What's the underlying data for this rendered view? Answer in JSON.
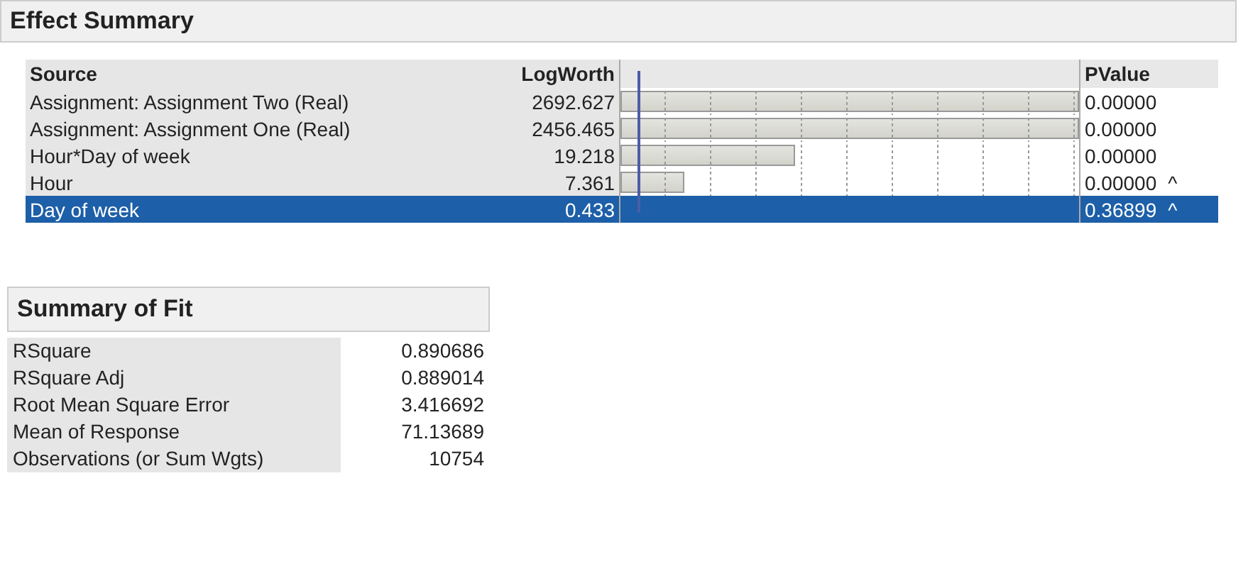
{
  "effect_summary": {
    "title": "Effect Summary",
    "columns": {
      "source": "Source",
      "logworth": "LogWorth",
      "pvalue": "PValue"
    },
    "rows": [
      {
        "source": "Assignment: Assignment Two (Real)",
        "logworth": "2692.627",
        "level": 1,
        "pvalue": "0.00000",
        "caret": "",
        "selected": false
      },
      {
        "source": "Assignment: Assignment One (Real)",
        "logworth": "2456.465",
        "level": 1,
        "pvalue": "0.00000",
        "caret": "",
        "selected": false
      },
      {
        "source": "Hour*Day of week",
        "logworth": "19.218",
        "level": 0.38,
        "pvalue": "0.00000",
        "caret": "",
        "selected": false
      },
      {
        "source": "Hour",
        "logworth": "7.361",
        "level": 0.14,
        "pvalue": "0.00000",
        "caret": "^",
        "selected": false
      },
      {
        "source": "Day of week",
        "logworth": "0.433",
        "level": 0.01,
        "pvalue": "0.36899",
        "caret": "^",
        "selected": true
      }
    ]
  },
  "summary_of_fit": {
    "title": "Summary of Fit",
    "rows": [
      {
        "label": "RSquare",
        "value": "0.890686"
      },
      {
        "label": "RSquare Adj",
        "value": "0.889014"
      },
      {
        "label": "Root Mean Square Error",
        "value": "3.416692"
      },
      {
        "label": "Mean of Response",
        "value": "71.13689"
      },
      {
        "label": "Observations (or Sum Wgts)",
        "value": "10754"
      }
    ]
  }
}
